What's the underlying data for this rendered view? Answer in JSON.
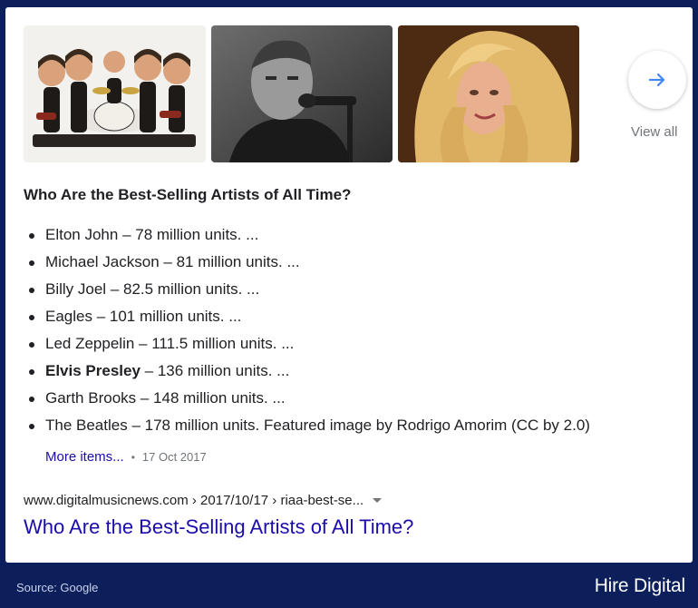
{
  "images": [
    {
      "alt": "Beatles caricature figurines",
      "icon": "band-figurines-image"
    },
    {
      "alt": "Singer at microphone (black and white)",
      "icon": "singer-microphone-image"
    },
    {
      "alt": "Blonde woman portrait",
      "icon": "woman-portrait-image"
    }
  ],
  "view_all": {
    "label": "View all",
    "icon": "arrow-right-icon",
    "accent": "#4285f4"
  },
  "snippet": {
    "heading": "Who Are the Best-Selling Artists of All Time?",
    "items": [
      {
        "name": "Elton John",
        "text": " – 78 million units. ..."
      },
      {
        "name": "Michael Jackson",
        "text": " – 81 million units. ..."
      },
      {
        "name": "Billy Joel",
        "text": " – 82.5 million units. ..."
      },
      {
        "name": "Eagles",
        "text": " – 101 million units. ..."
      },
      {
        "name": "Led Zeppelin",
        "text": " – 111.5 million units. ..."
      },
      {
        "name": "Elvis Presley",
        "text": " – 136 million units. ..."
      },
      {
        "name": "Garth Brooks",
        "text": " – 148 million units. ..."
      },
      {
        "name": "The Beatles",
        "text": " – 178 million units. Featured image by Rodrigo Amorim (CC by 2.0)"
      }
    ],
    "more_items": "More items...",
    "separator": "•",
    "date": "17 Oct 2017"
  },
  "result": {
    "url": "www.digitalmusicnews.com › 2017/10/17 › riaa-best-se...",
    "title": "Who Are the Best-Selling Artists of All Time?"
  },
  "footer": {
    "source": "Source: Google",
    "brand": "Hire Digital"
  },
  "colors": {
    "background": "#0c1f5a",
    "link": "#1a0dab",
    "meta": "#70757a"
  }
}
